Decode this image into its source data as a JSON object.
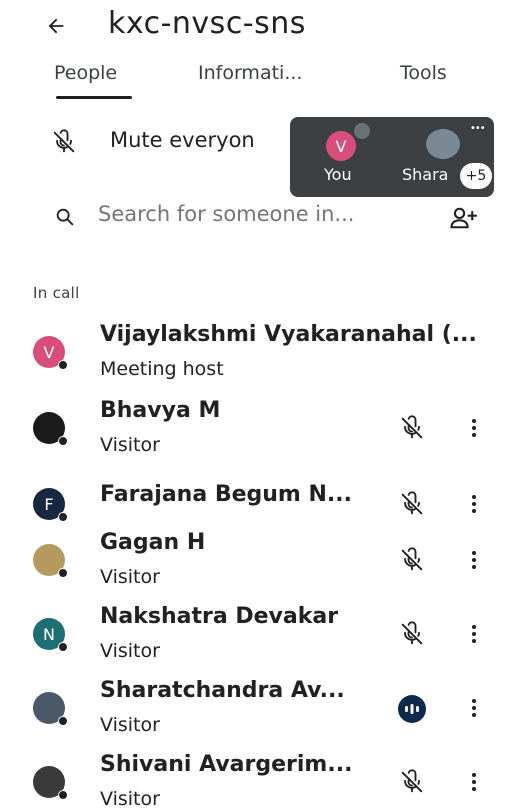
{
  "header": {
    "title": "kxc-nvsc-sns"
  },
  "tabs": [
    {
      "label": "People"
    },
    {
      "label": "Informati..."
    },
    {
      "label": "Tools"
    }
  ],
  "mute": {
    "label": "Mute everyon"
  },
  "pip": {
    "you_initial": "V",
    "you_label": "You",
    "share_label": "Shara",
    "more_count": "+5"
  },
  "search": {
    "placeholder": "Search for someone in..."
  },
  "section": {
    "in_call": "In call"
  },
  "participants": [
    {
      "name": "Vijaylakshmi Vyakaranahal (...",
      "role": "Meeting host",
      "initial": "V",
      "avatar_color": "#d94d7b"
    },
    {
      "name": "Bhavya M",
      "role": "Visitor",
      "initial": "",
      "avatar_color": "#1a1a1a"
    },
    {
      "name": "Farajana Begum N...",
      "role": "",
      "initial": "F",
      "avatar_color": "#1a2740"
    },
    {
      "name": "Gagan H",
      "role": "Visitor",
      "initial": "",
      "avatar_color": "#b59a5e"
    },
    {
      "name": "Nakshatra Devakar",
      "role": "Visitor",
      "initial": "N",
      "avatar_color": "#1e6e74"
    },
    {
      "name": "Sharatchandra Av...",
      "role": "Visitor",
      "initial": "",
      "avatar_color": "#4a5868"
    },
    {
      "name": "Shivani Avargerim...",
      "role": "Visitor",
      "initial": "",
      "avatar_color": "#3a3a3a"
    }
  ]
}
